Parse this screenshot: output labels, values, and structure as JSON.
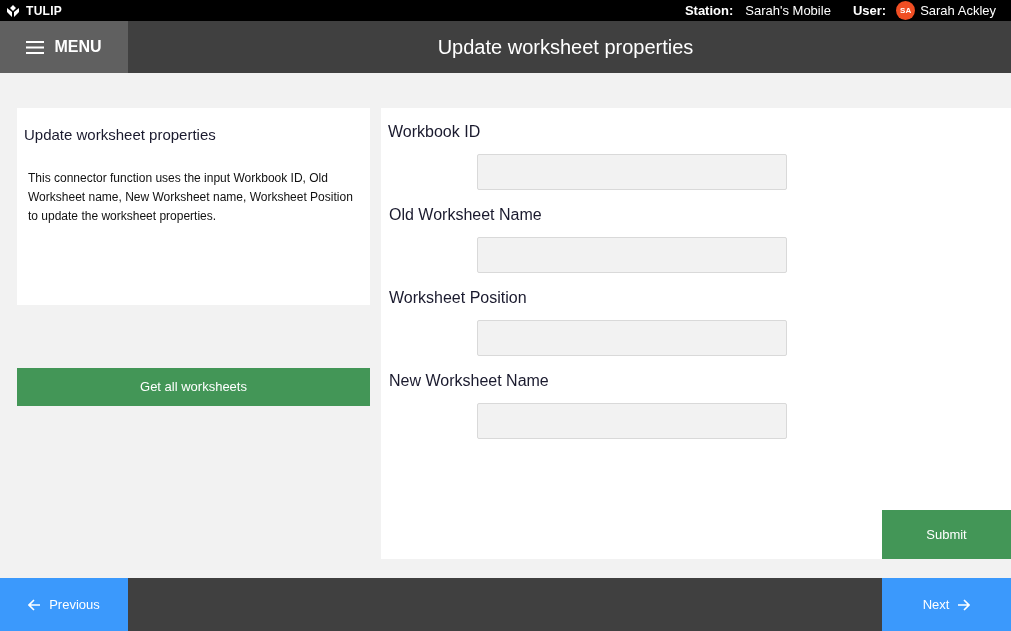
{
  "top_bar": {
    "brand": "TULIP",
    "station_label": "Station:",
    "station": "Sarah's Mobile",
    "user_label": "User:",
    "user_initials": "SA",
    "user": "Sarah Ackley"
  },
  "header": {
    "menu": "MENU",
    "title": "Update worksheet properties"
  },
  "info_card": {
    "title": "Update worksheet properties",
    "description": "This connector function uses the input Workbook ID, Old Worksheet name, New Worksheet name, Worksheet Position to update the worksheet properties."
  },
  "action_button": "Get all worksheets",
  "form": {
    "fields": [
      {
        "label": "Workbook ID"
      },
      {
        "label": "Old Worksheet Name"
      },
      {
        "label": "Worksheet Position"
      },
      {
        "label": "New Worksheet Name"
      }
    ],
    "submit": "Submit"
  },
  "footer": {
    "previous": "Previous",
    "next": "Next"
  }
}
